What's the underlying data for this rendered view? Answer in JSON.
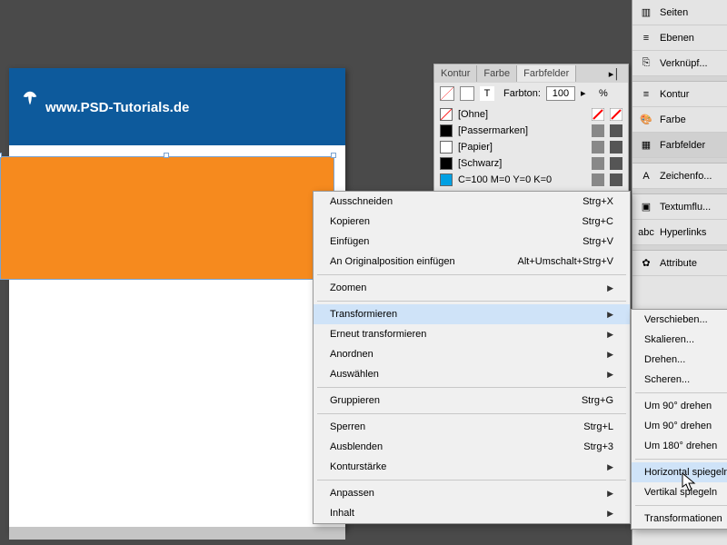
{
  "header": {
    "url": "www.PSD-Tutorials.de"
  },
  "swatch_panel": {
    "tabs": [
      "Kontur",
      "Farbe",
      "Farbfelder"
    ],
    "hue_label": "Farbton:",
    "hue_value": "100",
    "percent": "%",
    "swatches": [
      {
        "name": "[Ohne]",
        "color": "#ffffff",
        "slash": true
      },
      {
        "name": "[Passermarken]",
        "color": "#000000"
      },
      {
        "name": "[Papier]",
        "color": "#ffffff"
      },
      {
        "name": "[Schwarz]",
        "color": "#000000"
      },
      {
        "name": "C=100 M=0 Y=0 K=0",
        "color": "#00a0e3"
      }
    ]
  },
  "side": {
    "items": [
      {
        "label": "Seiten"
      },
      {
        "label": "Ebenen"
      },
      {
        "label": "Verknüpf..."
      },
      {
        "sep": true
      },
      {
        "label": "Kontur"
      },
      {
        "label": "Farbe"
      },
      {
        "label": "Farbfelder",
        "active": true
      },
      {
        "sep": true
      },
      {
        "label": "Zeichenfo..."
      },
      {
        "sep": true
      },
      {
        "label": "Textumflu..."
      },
      {
        "label": "Hyperlinks"
      },
      {
        "sep": true
      },
      {
        "label": "Attribute"
      }
    ]
  },
  "ctx": {
    "items": [
      {
        "label": "Ausschneiden",
        "shortcut": "Strg+X"
      },
      {
        "label": "Kopieren",
        "shortcut": "Strg+C"
      },
      {
        "label": "Einfügen",
        "shortcut": "Strg+V"
      },
      {
        "label": "An Originalposition einfügen",
        "shortcut": "Alt+Umschalt+Strg+V"
      },
      {
        "sep": true
      },
      {
        "label": "Zoomen",
        "arrow": true
      },
      {
        "sep": true
      },
      {
        "label": "Transformieren",
        "arrow": true,
        "highlight": true
      },
      {
        "label": "Erneut transformieren",
        "arrow": true
      },
      {
        "label": "Anordnen",
        "arrow": true
      },
      {
        "label": "Auswählen",
        "arrow": true
      },
      {
        "sep": true
      },
      {
        "label": "Gruppieren",
        "shortcut": "Strg+G"
      },
      {
        "sep": true
      },
      {
        "label": "Sperren",
        "shortcut": "Strg+L"
      },
      {
        "label": "Ausblenden",
        "shortcut": "Strg+3"
      },
      {
        "label": "Konturstärke",
        "arrow": true
      },
      {
        "sep": true
      },
      {
        "label": "Anpassen",
        "arrow": true
      },
      {
        "label": "Inhalt",
        "arrow": true
      }
    ]
  },
  "sub": {
    "items": [
      {
        "label": "Verschieben..."
      },
      {
        "label": "Skalieren..."
      },
      {
        "label": "Drehen..."
      },
      {
        "label": "Scheren..."
      },
      {
        "sep": true
      },
      {
        "label": "Um 90° drehen"
      },
      {
        "label": "Um 90° drehen"
      },
      {
        "label": "Um 180° drehen"
      },
      {
        "sep": true
      },
      {
        "label": "Horizontal spiegeln",
        "highlight": true
      },
      {
        "label": "Vertikal spiegeln"
      },
      {
        "sep": true
      },
      {
        "label": "Transformationen"
      }
    ]
  }
}
